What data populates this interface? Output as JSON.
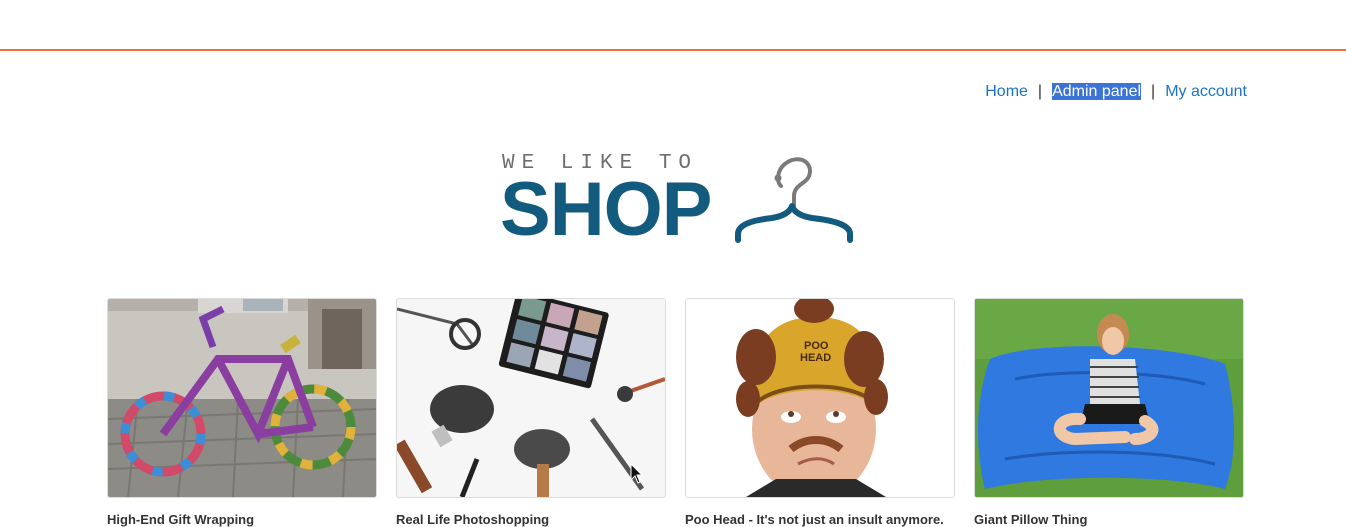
{
  "nav": {
    "items": [
      {
        "label": "Home",
        "selected": false
      },
      {
        "label": "Admin panel",
        "selected": true
      },
      {
        "label": "My account",
        "selected": false
      }
    ],
    "separator": "|"
  },
  "logo": {
    "tagline": "WE LIKE TO",
    "wordmark": "SHOP",
    "icon": "hanger-icon"
  },
  "colors": {
    "accent_bar": "#ef6c3b",
    "link": "#1a73c9",
    "brand": "#135b7e",
    "selection": "#3b74d6"
  },
  "products": [
    {
      "title": "High-End Gift Wrapping",
      "image": "yarn-bombed-bicycle"
    },
    {
      "title": "Real Life Photoshopping",
      "image": "makeup-brushes-and-eyeshadow"
    },
    {
      "title": "Poo Head - It's not just an insult anymore.",
      "image": "man-in-poo-head-hat"
    },
    {
      "title": "Giant Pillow Thing",
      "image": "girl-on-blue-giant-pillow"
    }
  ]
}
